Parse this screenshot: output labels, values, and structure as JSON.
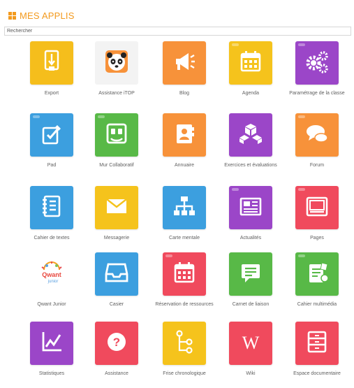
{
  "header": {
    "title": "MES APPLIS"
  },
  "search": {
    "placeholder": "Rechercher"
  },
  "apps": [
    {
      "label": "Export",
      "color": "#f5be1c",
      "icon": "export-icon"
    },
    {
      "label": "Assistance iTOP",
      "color": "#f3f3f3",
      "icon": "panda-icon"
    },
    {
      "label": "Blog",
      "color": "#f7923a",
      "icon": "megaphone-icon"
    },
    {
      "label": "Agenda",
      "color": "#f5c31c",
      "icon": "calendar-icon"
    },
    {
      "label": "Paramétrage de la classe",
      "color": "#9b46c8",
      "icon": "gears-icon"
    },
    {
      "label": "Pad",
      "color": "#3c9fdf",
      "icon": "pad-icon"
    },
    {
      "label": "Mur Collaboratif",
      "color": "#58b947",
      "icon": "wall-icon"
    },
    {
      "label": "Annuaire",
      "color": "#f7923a",
      "icon": "contacts-icon"
    },
    {
      "label": "Exercices et évaluations",
      "color": "#9b46c8",
      "icon": "cubes-icon"
    },
    {
      "label": "Forum",
      "color": "#f7923a",
      "icon": "speech-bubbles-icon"
    },
    {
      "label": "Cahier de textes",
      "color": "#3c9fdf",
      "icon": "notebook-icon"
    },
    {
      "label": "Messagerie",
      "color": "#f5c31c",
      "icon": "envelope-icon"
    },
    {
      "label": "Carte mentale",
      "color": "#3c9fdf",
      "icon": "mindmap-icon"
    },
    {
      "label": "Actualités",
      "color": "#9b46c8",
      "icon": "newspaper-icon"
    },
    {
      "label": "Pages",
      "color": "#f04a5d",
      "icon": "page-window-icon"
    },
    {
      "label": "Qwant Junior",
      "color": "#ffffff",
      "icon": "qwant-junior-logo"
    },
    {
      "label": "Casier",
      "color": "#3c9fdf",
      "icon": "inbox-tray-icon"
    },
    {
      "label": "Réservation de ressources",
      "color": "#f04a5d",
      "icon": "calendar-grid-icon"
    },
    {
      "label": "Carnet de liaison",
      "color": "#58b947",
      "icon": "message-icon"
    },
    {
      "label": "Cahier multimédia",
      "color": "#58b947",
      "icon": "multimedia-notebook-icon"
    },
    {
      "label": "Statistiques",
      "color": "#9b46c8",
      "icon": "chart-line-icon"
    },
    {
      "label": "Assistance",
      "color": "#f04a5d",
      "icon": "question-icon"
    },
    {
      "label": "Frise chronologique",
      "color": "#f5c31c",
      "icon": "timeline-icon"
    },
    {
      "label": "Wiki",
      "color": "#f04a5d",
      "icon": "wiki-icon"
    },
    {
      "label": "Espace documentaire",
      "color": "#f04a5d",
      "icon": "drawers-icon"
    }
  ]
}
